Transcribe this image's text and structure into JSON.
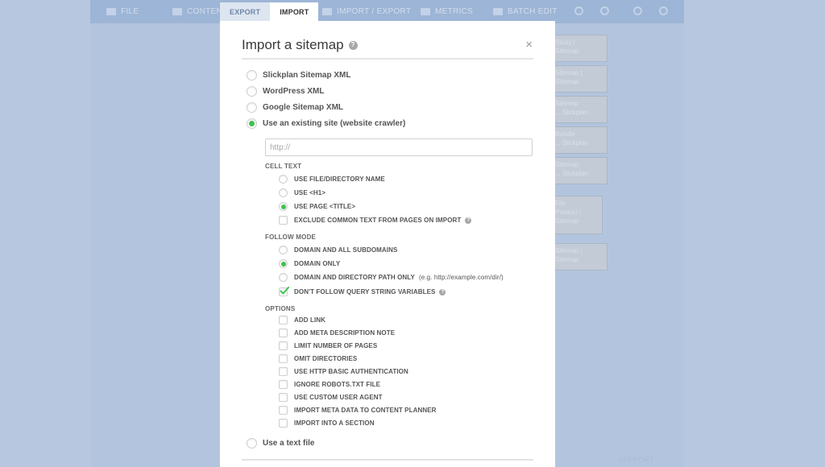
{
  "app": {
    "toolbar": [
      "File",
      "Content",
      "Import / Export",
      "Metrics",
      "Batch Edit"
    ],
    "bottom_link": "Support",
    "cards": [
      [
        "Study |",
        "Sitemap"
      ],
      [
        "Sitemap |",
        "Sitemap"
      ],
      [
        "Sitemap",
        "... Slickplan"
      ],
      [
        "Bundle",
        "... Slickplan"
      ],
      [
        "Sitemap",
        "... Slickplan"
      ],
      [
        "File",
        "Product |",
        "Sitemap"
      ],
      [
        "Sitemap |",
        "Sitemap"
      ]
    ]
  },
  "tabs": [
    {
      "label": "EXPORT",
      "active": false
    },
    {
      "label": "IMPORT",
      "active": true
    }
  ],
  "modal": {
    "title": "Import a sitemap",
    "help_glyph": "?",
    "close_glyph": "×",
    "sources": [
      {
        "label": "Slickplan Sitemap XML",
        "checked": false
      },
      {
        "label": "WordPress XML",
        "checked": false
      },
      {
        "label": "Google Sitemap XML",
        "checked": false
      },
      {
        "label": "Use an existing site (website crawler)",
        "checked": true
      }
    ],
    "url_input": {
      "value": "",
      "placeholder": "http://"
    },
    "cell_text": {
      "heading": "CELL TEXT",
      "options": [
        {
          "label": "USE FILE/DIRECTORY NAME",
          "checked": false
        },
        {
          "label": "USE <H1>",
          "checked": false
        },
        {
          "label": "USE PAGE <TITLE>",
          "checked": true
        }
      ],
      "exclude": {
        "label": "EXCLUDE COMMON TEXT FROM PAGES ON IMPORT",
        "checked": false
      }
    },
    "follow_mode": {
      "heading": "FOLLOW MODE",
      "options": [
        {
          "label": "DOMAIN AND ALL SUBDOMAINS",
          "note": "",
          "checked": false
        },
        {
          "label": "DOMAIN ONLY",
          "note": "",
          "checked": true
        },
        {
          "label": "DOMAIN AND DIRECTORY PATH ONLY",
          "note": "(e.g. http://example.com/dir/)",
          "checked": false
        }
      ],
      "query_string": {
        "label": "DON'T FOLLOW QUERY STRING VARIABLES",
        "checked": true
      }
    },
    "options": {
      "heading": "OPTIONS",
      "items": [
        {
          "label": "ADD LINK",
          "checked": false
        },
        {
          "label": "ADD META DESCRIPTION NOTE",
          "checked": false
        },
        {
          "label": "LIMIT NUMBER OF PAGES",
          "checked": false
        },
        {
          "label": "OMIT DIRECTORIES",
          "checked": false
        },
        {
          "label": "USE HTTP BASIC AUTHENTICATION",
          "checked": false
        },
        {
          "label": "IGNORE ROBOTS.TXT FILE",
          "checked": false
        },
        {
          "label": "USE CUSTOM USER AGENT",
          "checked": false
        },
        {
          "label": "IMPORT META DATA TO CONTENT PLANNER",
          "checked": false
        },
        {
          "label": "IMPORT INTO A SECTION",
          "checked": false
        }
      ]
    },
    "text_file": {
      "label": "Use a text file",
      "checked": false
    }
  }
}
